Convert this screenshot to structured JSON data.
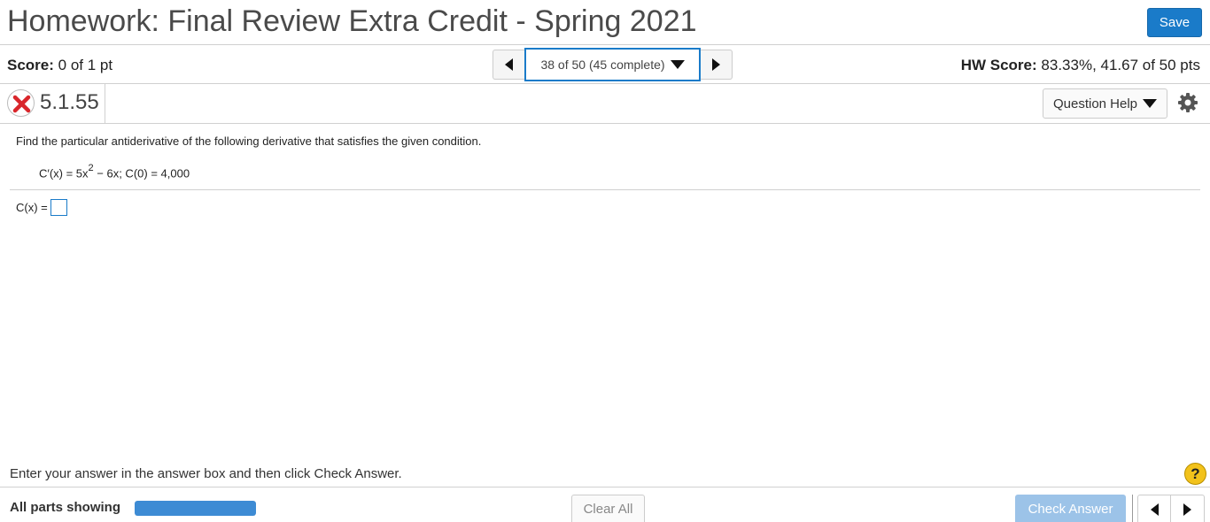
{
  "header": {
    "title": "Homework: Final Review Extra Credit - Spring 2021",
    "save_label": "Save"
  },
  "scorebar": {
    "score_label": "Score:",
    "score_value": "0 of 1 pt",
    "nav_position": "38 of 50 (45 complete)",
    "hw_score_label": "HW Score:",
    "hw_score_value": "83.33%, 41.67 of 50 pts"
  },
  "question": {
    "status_icon": "x-mark-icon",
    "number": "5.1.55",
    "help_label": "Question Help",
    "prompt": "Find the particular antiderivative of the following derivative that satisfies the given condition.",
    "equation_lhs": "C′(x) = 5x",
    "equation_exp": "2",
    "equation_rest": " − 6x; C(0) = 4,000",
    "answer_label": "C(x) =",
    "answer_value": ""
  },
  "footer": {
    "instruction": "Enter your answer in the answer box and then click Check Answer.",
    "help_symbol": "?",
    "parts_label": "All parts showing",
    "parts_progress": 1.0,
    "clear_label": "Clear All",
    "check_label": "Check Answer"
  },
  "colors": {
    "accent": "#1a7bc9",
    "error": "#d9262b",
    "progress": "#3d8bd4",
    "check_disabled": "#9cc3e8",
    "help_yellow": "#f2c21b"
  }
}
